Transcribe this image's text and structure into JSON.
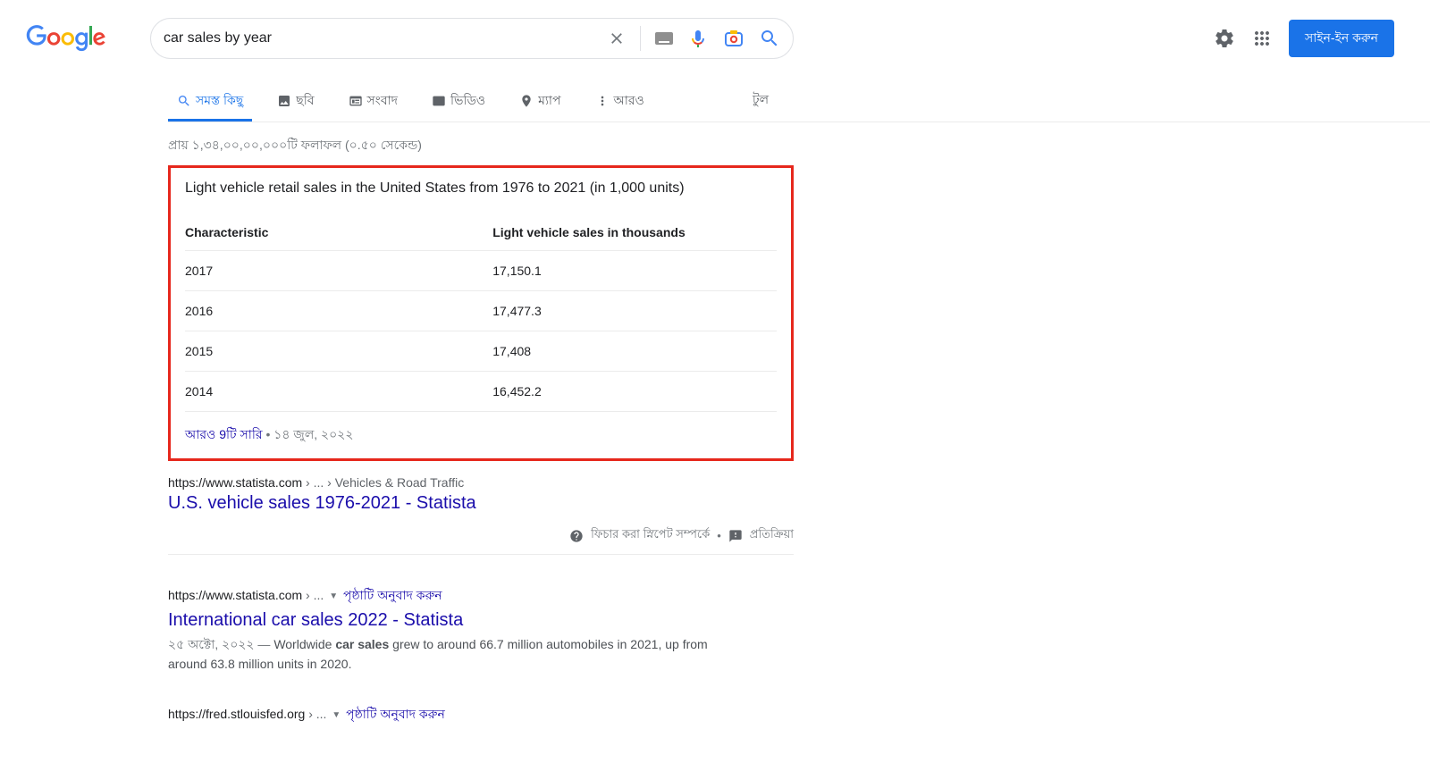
{
  "search": {
    "query": "car sales by year"
  },
  "header": {
    "signin": "সাইন-ইন করুন"
  },
  "tabs": {
    "all": "সমস্ত কিছু",
    "images": "ছবি",
    "news": "সংবাদ",
    "videos": "ভিডিও",
    "maps": "ম্যাপ",
    "more": "আরও",
    "tools": "টুল"
  },
  "stats": "প্রায় ১,৩৪,০০,০০,০০০টি ফলাফল (০.৫০ সেকেন্ড)",
  "snippet": {
    "title": "Light vehicle retail sales in the United States from 1976 to 2021 (in 1,000 units)",
    "col1": "Characteristic",
    "col2": "Light vehicle sales in thousands",
    "rows": [
      {
        "year": "2017",
        "value": "17,150.1"
      },
      {
        "year": "2016",
        "value": "17,477.3"
      },
      {
        "year": "2015",
        "value": "17,408"
      },
      {
        "year": "2014",
        "value": "16,452.2"
      }
    ],
    "more_rows": "আরও 9টি সারি",
    "date": "১৪ জুল, ২০২২",
    "about": "ফিচার করা স্নিপেট সম্পর্কে",
    "feedback": "প্রতিক্রিয়া"
  },
  "results": [
    {
      "url_host": "https://www.statista.com",
      "url_path": " › ... › Vehicles & Road Traffic",
      "title": "U.S. vehicle sales 1976-2021 - Statista"
    },
    {
      "url_host": "https://www.statista.com",
      "url_path": " › ...",
      "translate": "পৃষ্ঠাটি অনুবাদ করুন",
      "title": "International car sales 2022 - Statista",
      "date_inline": "২৫ অক্টো, ২০২২ — ",
      "desc_pre": "Worldwide ",
      "desc_bold": "car sales",
      "desc_post": " grew to around 66.7 million automobiles in 2021, up from around 63.8 million units in 2020."
    },
    {
      "url_host": "https://fred.stlouisfed.org",
      "url_path": " › ...",
      "translate": "পৃষ্ঠাটি অনুবাদ করুন"
    }
  ],
  "chart_data": {
    "type": "table",
    "title": "Light vehicle retail sales in the United States from 1976 to 2021 (in 1,000 units)",
    "columns": [
      "Characteristic",
      "Light vehicle sales in thousands"
    ],
    "rows": [
      [
        "2017",
        17150.1
      ],
      [
        "2016",
        17477.3
      ],
      [
        "2015",
        17408
      ],
      [
        "2014",
        16452.2
      ]
    ]
  }
}
